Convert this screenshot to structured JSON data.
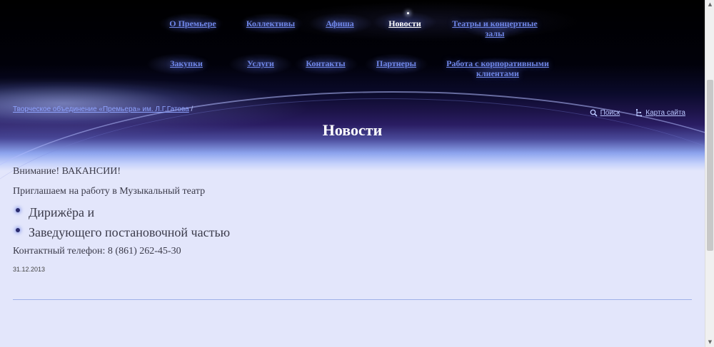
{
  "nav": {
    "row1": [
      {
        "label": "О Премьере"
      },
      {
        "label": "Коллективы"
      },
      {
        "label": "Афиша"
      },
      {
        "label": "Новости"
      },
      {
        "label": "Театры и концертные залы"
      }
    ],
    "row2": [
      {
        "label": "Закупки"
      },
      {
        "label": "Услуги"
      },
      {
        "label": "Контакты"
      },
      {
        "label": "Партнеры"
      },
      {
        "label": "Работа с корпоративными клиентами"
      }
    ]
  },
  "breadcrumb": {
    "home": "Творческое объединение «Премьера» им. Л.Г.Гатова",
    "separator": " /"
  },
  "tools": {
    "search": "Поиск",
    "sitemap": "Карта сайта"
  },
  "page": {
    "title": "Новости"
  },
  "article": {
    "heading": "Внимание! ВАКАНСИИ!",
    "intro": "Приглашаем на работу в Музыкальный театр",
    "items": [
      "Дирижёра и",
      "Заведующего постановочной частью"
    ],
    "phone": "Контактный телефон: 8 (861) 262-45-30",
    "date": "31.12.2013"
  }
}
